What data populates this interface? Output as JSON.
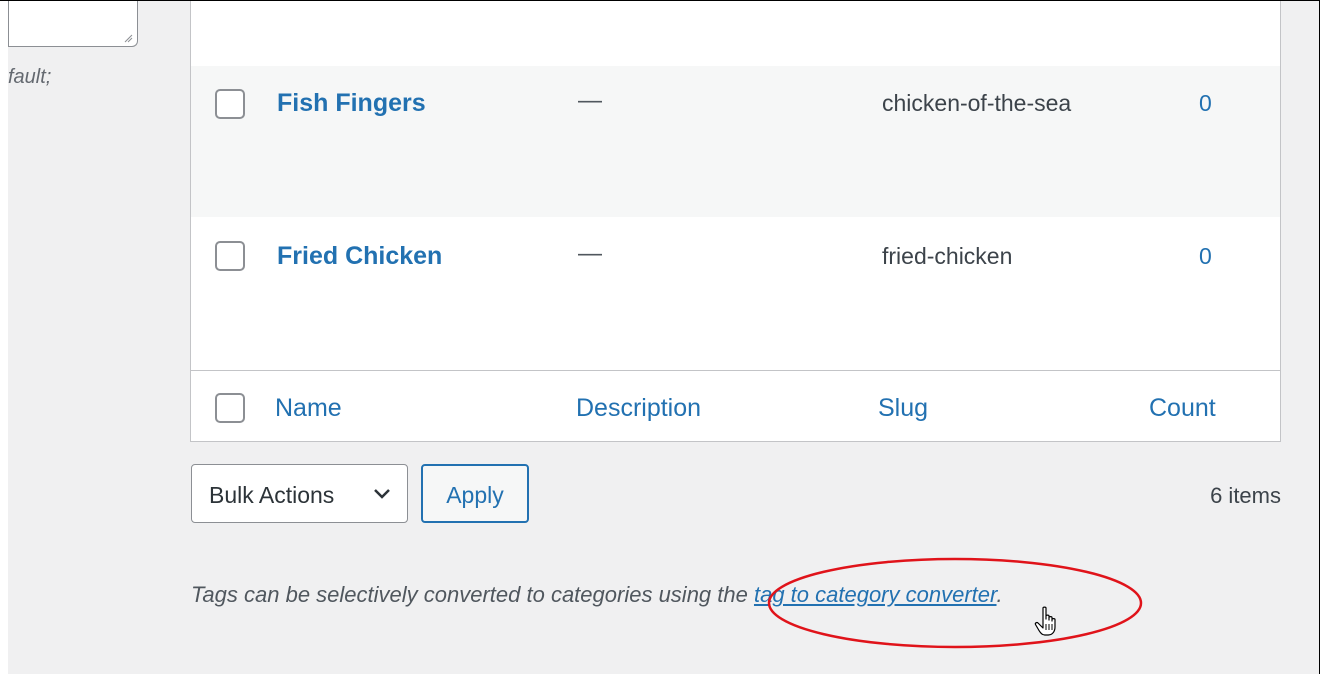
{
  "left_panel": {
    "fragment_text": "fault;"
  },
  "tags_table": {
    "rows": [
      {
        "name": "Fish Fingers",
        "description": "—",
        "slug": "chicken-of-the-sea",
        "count": "0"
      },
      {
        "name": "Fried Chicken",
        "description": "—",
        "slug": "fried-chicken",
        "count": "0"
      }
    ],
    "footer_headers": {
      "name": "Name",
      "description": "Description",
      "slug": "Slug",
      "count": "Count"
    }
  },
  "bulk_actions": {
    "selected": "Bulk Actions",
    "apply_label": "Apply"
  },
  "items_count": "6 items",
  "converter_note": {
    "text_before": "Tags can be selectively converted to categories using the ",
    "link_text": "tag to category converter",
    "text_after": "."
  },
  "annotation": {
    "ellipse_color": "#e0131a"
  }
}
